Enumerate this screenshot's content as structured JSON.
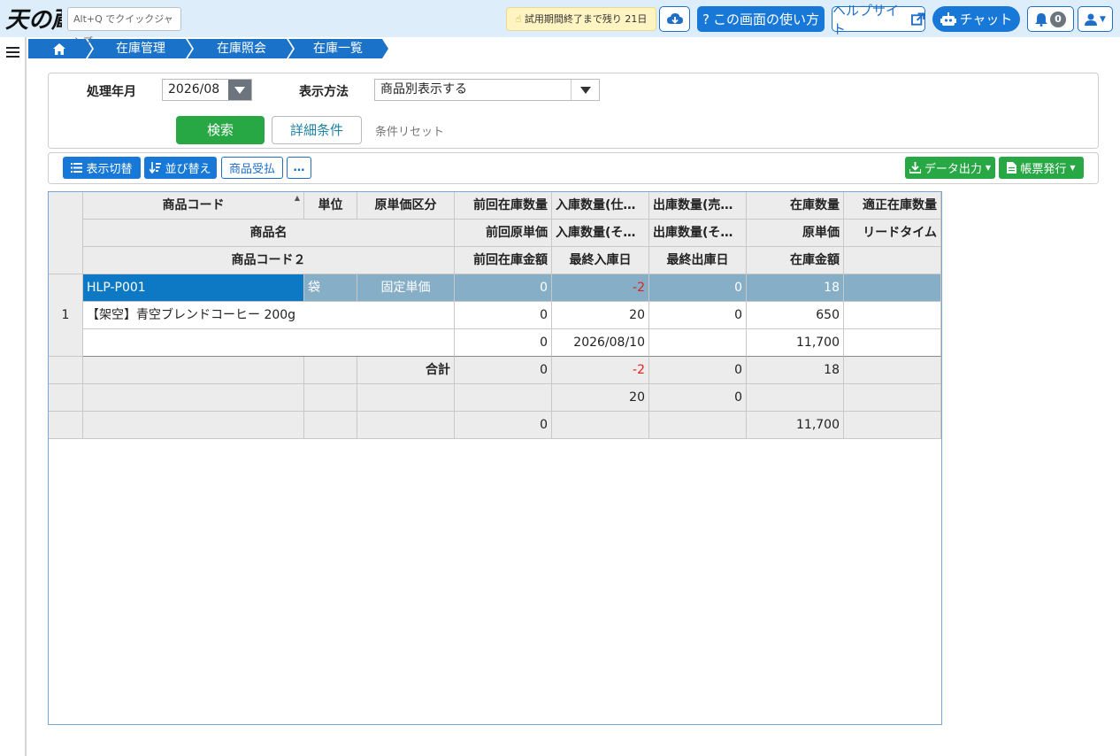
{
  "header": {
    "logo_text": "天の蔵",
    "quick_jump_placeholder": "Alt+Q でクイックジャンプ",
    "trial_notice": "試用期間終了まで残り 21日",
    "usage_button": "この画面の使い方",
    "help_site_button": "ヘルプサイト",
    "chat_button": "チャット",
    "notification_count": "0",
    "icons": [
      "download-icon",
      "question-icon",
      "external-link-icon",
      "robot-icon",
      "bell-icon",
      "user-icon"
    ]
  },
  "breadcrumb": {
    "items": [
      "在庫管理",
      "在庫照会",
      "在庫一覧"
    ]
  },
  "search": {
    "period_label": "処理年月",
    "period_value": "2026/08",
    "display_label": "表示方法",
    "display_value": "商品別表示する",
    "search_button": "検索",
    "detail_button": "詳細条件",
    "reset_link": "条件リセット"
  },
  "toolbar": {
    "toggle_view": "表示切替",
    "sort": "並び替え",
    "receipts": "商品受払",
    "more": "…",
    "data_export": "データ出力",
    "report_issue": "帳票発行"
  },
  "grid": {
    "headers": {
      "row1": [
        "商品コード",
        "単位",
        "原単価区分",
        "前回在庫数量",
        "入庫数量(仕…",
        "出庫数量(売…",
        "在庫数量",
        "適正在庫数量"
      ],
      "row2": [
        "商品名",
        "前回原単価",
        "入庫数量(そ…",
        "出庫数量(そ…",
        "原単価",
        "リードタイム"
      ],
      "row3": [
        "商品コード２",
        "前回在庫金額",
        "最終入庫日",
        "最終出庫日",
        "在庫金額",
        ""
      ]
    },
    "record": {
      "row_number": "1",
      "code": "HLP-P001",
      "unit": "袋",
      "cost_type": "固定単価",
      "prev_qty": "0",
      "in_qty_purchase": "-2",
      "out_qty_sales": "0",
      "stock_qty": "18",
      "proper_qty": "",
      "name": "【架空】青空ブレンドコーヒー 200g",
      "prev_unit_cost": "0",
      "in_qty_other": "20",
      "out_qty_other": "0",
      "unit_cost": "650",
      "lead_time": "",
      "code2": "",
      "prev_amount": "0",
      "last_in_date": "2026/08/10",
      "last_out_date": "",
      "stock_amount": "11,700"
    },
    "totals": {
      "label": "合計",
      "r1": [
        "0",
        "-2",
        "0",
        "18"
      ],
      "r2": [
        "",
        "20",
        "0",
        ""
      ],
      "r3": [
        "0",
        "",
        "",
        "11,700"
      ]
    }
  },
  "colors": {
    "topbar_bg": "#ddeefa",
    "primary": "#1778d8",
    "success": "#28a745",
    "selected_row": "#86aec6",
    "negative": "#e02020"
  }
}
